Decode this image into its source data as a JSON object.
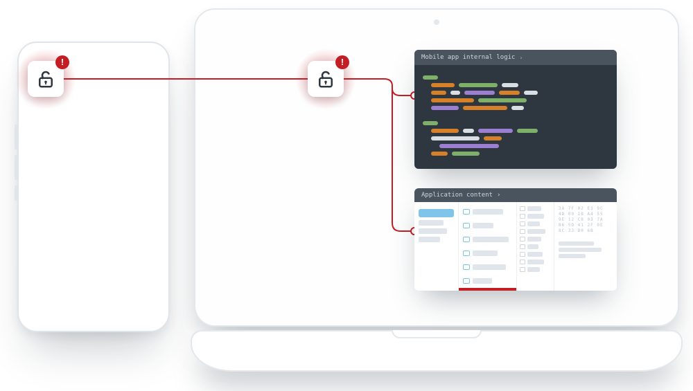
{
  "diagram": {
    "phone_vuln_alert": "!",
    "laptop_vuln_alert": "!"
  },
  "code_panel": {
    "title": "Mobile app internal logic",
    "chevron": "›"
  },
  "content_panel": {
    "title": "Application content",
    "chevron": "›"
  }
}
